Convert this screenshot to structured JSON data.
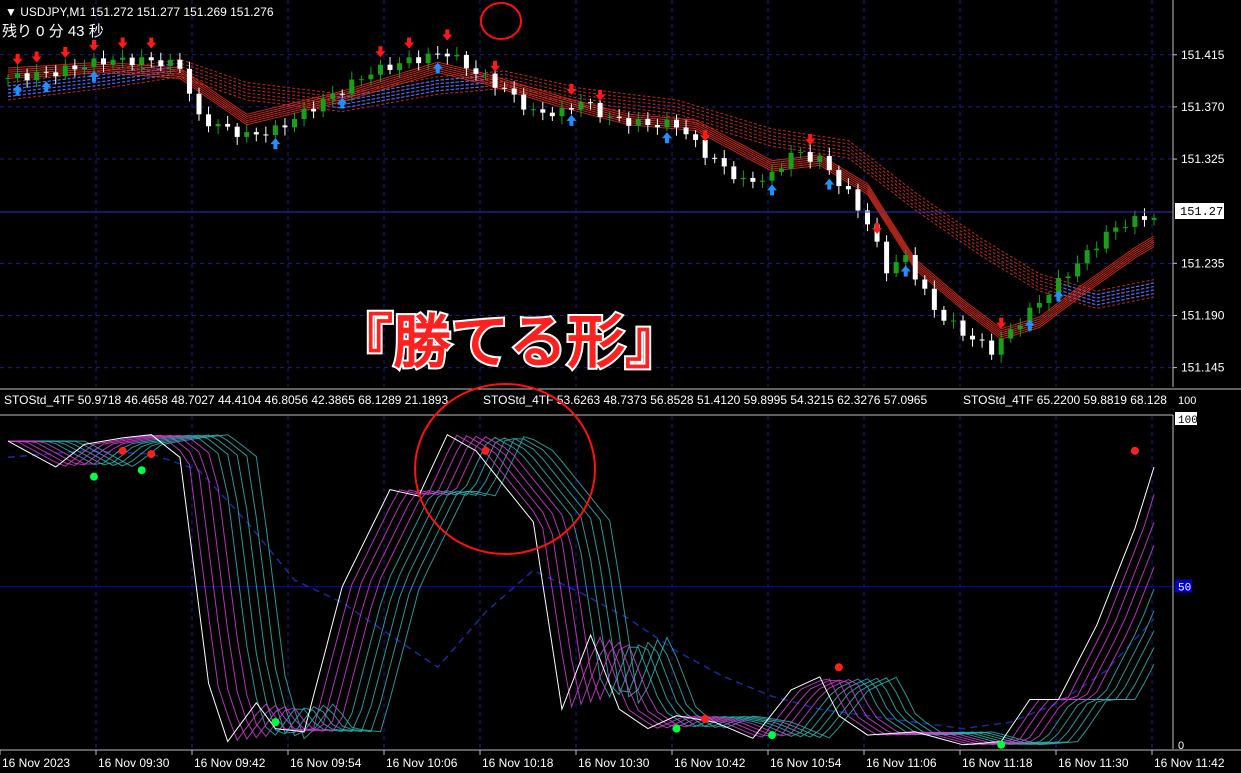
{
  "window": {
    "title": "USDJPY,M1",
    "quote": "151.272 151.277 151.269 151.276",
    "timer": "残り 0 分 43 秒"
  },
  "overlay_caption": "『勝てる形』",
  "colors": {
    "background": "#000000",
    "grid": "#1c1c8c",
    "bull_candle": "#18a018",
    "bear_candle": "#ffffff",
    "up_arrow": "#1e90ff",
    "down_arrow": "#ff1a1a",
    "ribbon_red": "#e03020",
    "ribbon_blue": "#3b6cff",
    "sto_magenta": "#d040d0",
    "sto_teal": "#30b0b0",
    "sto_white": "#ffffff",
    "signal_green": "#00ff40",
    "signal_red": "#ff2020",
    "highlight_circle": "#ff1010",
    "level_line": "#0000c8"
  },
  "chart_data": [
    {
      "type": "candlestick",
      "symbol": "USDJPY",
      "timeframe": "M1",
      "current_price": "151.276",
      "y_ticks": [
        "151.415",
        "151.370",
        "151.325",
        "151.235",
        "151.190",
        "151.145"
      ],
      "ylim": [
        151.13,
        151.445
      ],
      "close_path": [
        [
          0,
          151.395
        ],
        [
          5,
          151.4
        ],
        [
          10,
          151.41
        ],
        [
          15,
          151.41
        ],
        [
          18,
          151.405
        ],
        [
          20,
          151.36
        ],
        [
          25,
          151.345
        ],
        [
          28,
          151.35
        ],
        [
          32,
          151.37
        ],
        [
          38,
          151.4
        ],
        [
          42,
          151.41
        ],
        [
          46,
          151.417
        ],
        [
          48,
          151.405
        ],
        [
          52,
          151.385
        ],
        [
          55,
          151.365
        ],
        [
          58,
          151.365
        ],
        [
          60,
          151.375
        ],
        [
          63,
          151.36
        ],
        [
          67,
          151.355
        ],
        [
          70,
          151.355
        ],
        [
          73,
          151.33
        ],
        [
          77,
          151.305
        ],
        [
          80,
          151.31
        ],
        [
          82,
          151.33
        ],
        [
          85,
          151.325
        ],
        [
          88,
          151.295
        ],
        [
          90,
          151.27
        ],
        [
          92,
          151.23
        ],
        [
          94,
          151.24
        ],
        [
          97,
          151.195
        ],
        [
          100,
          151.175
        ],
        [
          103,
          151.16
        ],
        [
          106,
          151.185
        ],
        [
          109,
          151.21
        ],
        [
          112,
          151.235
        ],
        [
          115,
          151.26
        ],
        [
          117,
          151.27
        ],
        [
          120,
          151.276
        ]
      ],
      "fast_ribbon_path": [
        [
          0,
          151.4
        ],
        [
          10,
          151.405
        ],
        [
          18,
          151.4
        ],
        [
          25,
          151.36
        ],
        [
          35,
          151.38
        ],
        [
          45,
          151.405
        ],
        [
          50,
          151.395
        ],
        [
          58,
          151.375
        ],
        [
          65,
          151.36
        ],
        [
          72,
          151.355
        ],
        [
          80,
          151.32
        ],
        [
          85,
          151.325
        ],
        [
          90,
          151.3
        ],
        [
          95,
          151.235
        ],
        [
          100,
          151.2
        ],
        [
          104,
          151.175
        ],
        [
          108,
          151.185
        ],
        [
          112,
          151.21
        ],
        [
          118,
          151.245
        ],
        [
          120,
          151.255
        ]
      ],
      "slow_ribbon_path": [
        [
          0,
          151.385
        ],
        [
          10,
          151.395
        ],
        [
          18,
          151.405
        ],
        [
          25,
          151.385
        ],
        [
          35,
          151.375
        ],
        [
          45,
          151.39
        ],
        [
          52,
          151.395
        ],
        [
          60,
          151.38
        ],
        [
          70,
          151.37
        ],
        [
          80,
          151.345
        ],
        [
          88,
          151.335
        ],
        [
          95,
          151.29
        ],
        [
          102,
          151.25
        ],
        [
          108,
          151.22
        ],
        [
          114,
          151.205
        ],
        [
          120,
          151.215
        ]
      ],
      "up_arrows": [
        1,
        4,
        9,
        28,
        35,
        45,
        59,
        69,
        80,
        86,
        94,
        107,
        110
      ],
      "down_arrows": [
        1,
        3,
        6,
        9,
        12,
        15,
        39,
        42,
        46,
        51,
        59,
        62,
        73,
        84,
        91,
        104
      ],
      "annotation": "highlighted sell arrow at bar 51"
    },
    {
      "type": "line",
      "indicator": "STOStd_4TF",
      "readout_1": "STOStd_4TF 50.9718 46.4658 48.7027 44.4104 46.8056 42.3865 68.1289 21.1893",
      "readout_2": "STOStd_4TF 53.6263 48.7373 56.8528 51.4120 59.8995 54.3215 62.3276 57.0965",
      "readout_3": "STOStd_4TF 65.2200 59.8819 68.128",
      "y_ticks": [
        "100",
        "50",
        "0"
      ],
      "ylim": [
        0,
        100
      ],
      "level": 50,
      "fast_path": [
        [
          0,
          95
        ],
        [
          5,
          87
        ],
        [
          8,
          94
        ],
        [
          12,
          96
        ],
        [
          15,
          97
        ],
        [
          18,
          90
        ],
        [
          21,
          20
        ],
        [
          23,
          2
        ],
        [
          26,
          14
        ],
        [
          28,
          6
        ],
        [
          31,
          5
        ],
        [
          35,
          50
        ],
        [
          40,
          80
        ],
        [
          43,
          78
        ],
        [
          46,
          97
        ],
        [
          49,
          92
        ],
        [
          52,
          81
        ],
        [
          55,
          70
        ],
        [
          58,
          12
        ],
        [
          61,
          35
        ],
        [
          64,
          12
        ],
        [
          67,
          6
        ],
        [
          70,
          10
        ],
        [
          74,
          8
        ],
        [
          78,
          3
        ],
        [
          82,
          18
        ],
        [
          85,
          22
        ],
        [
          87,
          10
        ],
        [
          90,
          4
        ],
        [
          95,
          5
        ],
        [
          100,
          1
        ],
        [
          104,
          2
        ],
        [
          107,
          15
        ],
        [
          110,
          15
        ],
        [
          114,
          38
        ],
        [
          118,
          68
        ],
        [
          120,
          87
        ]
      ],
      "slow_path": [
        [
          0,
          90
        ],
        [
          8,
          92
        ],
        [
          15,
          91
        ],
        [
          20,
          86
        ],
        [
          25,
          70
        ],
        [
          30,
          52
        ],
        [
          35,
          45
        ],
        [
          40,
          35
        ],
        [
          45,
          25
        ],
        [
          50,
          42
        ],
        [
          55,
          55
        ],
        [
          60,
          48
        ],
        [
          65,
          40
        ],
        [
          70,
          30
        ],
        [
          75,
          22
        ],
        [
          80,
          16
        ],
        [
          85,
          12
        ],
        [
          90,
          10
        ],
        [
          95,
          8
        ],
        [
          100,
          6
        ],
        [
          105,
          8
        ],
        [
          110,
          14
        ],
        [
          115,
          24
        ],
        [
          120,
          40
        ]
      ],
      "green_dots": [
        [
          9,
          84
        ],
        [
          14,
          86
        ],
        [
          28,
          8
        ],
        [
          70,
          6
        ],
        [
          80,
          4
        ],
        [
          104,
          1
        ]
      ],
      "red_dots": [
        [
          12,
          92
        ],
        [
          15,
          91
        ],
        [
          50,
          92
        ],
        [
          73,
          9
        ],
        [
          87,
          25
        ],
        [
          118,
          92
        ]
      ],
      "annotation": "highlighted peak near bar 49"
    }
  ],
  "time_axis": {
    "labels": [
      "16 Nov 2023",
      "16 Nov 09:30",
      "16 Nov 09:42",
      "16 Nov 09:54",
      "16 Nov 10:06",
      "16 Nov 10:18",
      "16 Nov 10:30",
      "16 Nov 10:42",
      "16 Nov 10:54",
      "16 Nov 11:06",
      "16 Nov 11:18",
      "16 Nov 11:30",
      "16 Nov 11:42"
    ]
  }
}
